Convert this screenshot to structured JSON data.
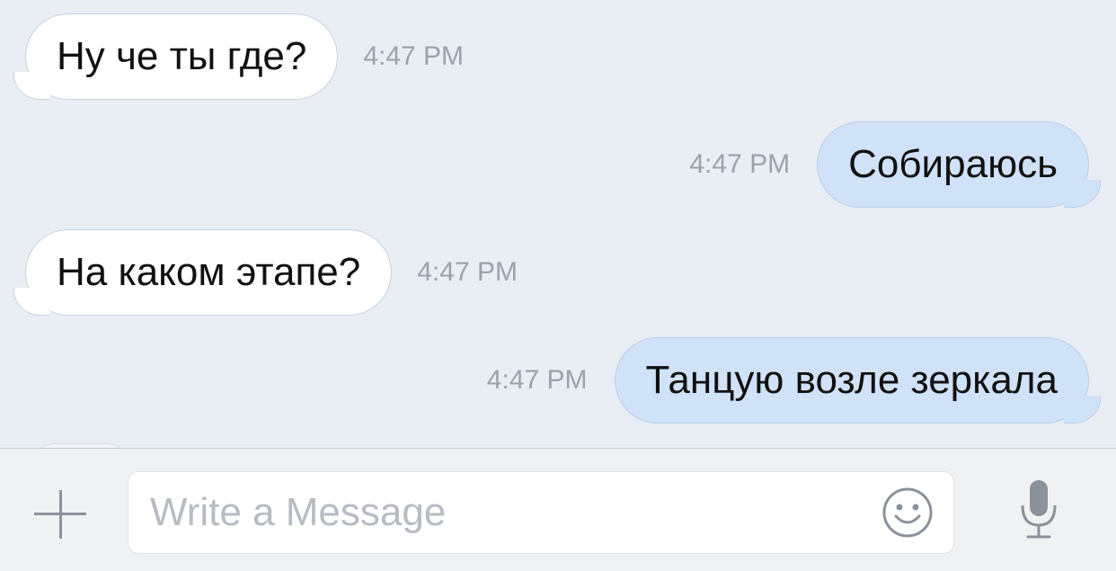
{
  "messages": [
    {
      "direction": "incoming",
      "text": "Ну че ты где?",
      "time": "4:47 PM"
    },
    {
      "direction": "outgoing",
      "text": "Собираюсь",
      "time": "4:47 PM"
    },
    {
      "direction": "incoming",
      "text": "На каком этапе?",
      "time": "4:47 PM"
    },
    {
      "direction": "outgoing",
      "text": "Танцую возле зеркала",
      "time": "4:47 PM"
    }
  ],
  "composer": {
    "placeholder": "Write a Message",
    "attach_icon": "plus-icon",
    "emoji_icon": "smiley-icon",
    "voice_icon": "microphone-icon"
  },
  "colors": {
    "background": "#e9eef5",
    "incoming_bubble": "#ffffff",
    "outgoing_bubble": "#cfe2f8",
    "timestamp": "#9aa3ad",
    "placeholder": "#b7bcc3"
  }
}
